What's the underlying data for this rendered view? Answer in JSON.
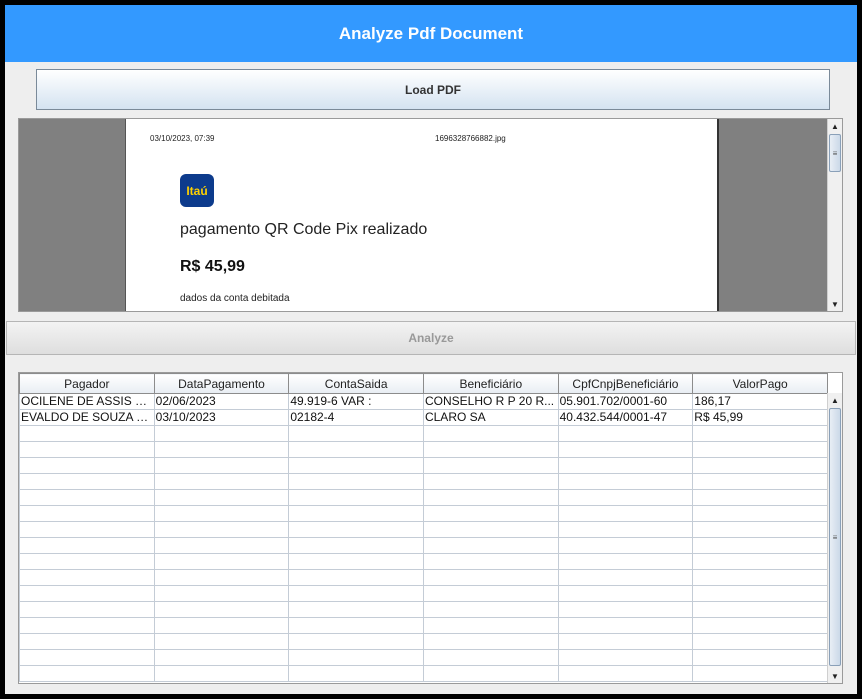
{
  "window": {
    "title": "Analyze Pdf Document"
  },
  "toolbar": {
    "load_label": "Load PDF",
    "analyze_label": "Analyze"
  },
  "pdf_preview": {
    "date": "03/10/2023, 07:39",
    "file_name": "1696328766882.jpg",
    "bank_logo": "Itaú",
    "heading": "pagamento QR Code Pix realizado",
    "amount": "R$ 45,99",
    "section": "dados da conta debitada"
  },
  "table": {
    "columns": [
      "Pagador",
      "DataPagamento",
      "ContaSaida",
      "Beneficiário",
      "CpfCnpjBeneficiário",
      "ValorPago"
    ],
    "rows": [
      [
        "OCILENE DE ASSIS LI...",
        "02/06/2023",
        "49.919-6 VAR :",
        "CONSELHO R P 20 R...",
        "05.901.702/0001-60",
        "186,17"
      ],
      [
        "EVALDO DE SOUZA LI...",
        "03/10/2023",
        "02182-4",
        "CLARO SA",
        "40.432.544/0001-47",
        "R$ 45,99"
      ]
    ]
  },
  "icons": {
    "scroll_up": "scroll-up-arrow-icon",
    "scroll_down": "scroll-down-arrow-icon",
    "grip": "scroll-grip-icon"
  }
}
